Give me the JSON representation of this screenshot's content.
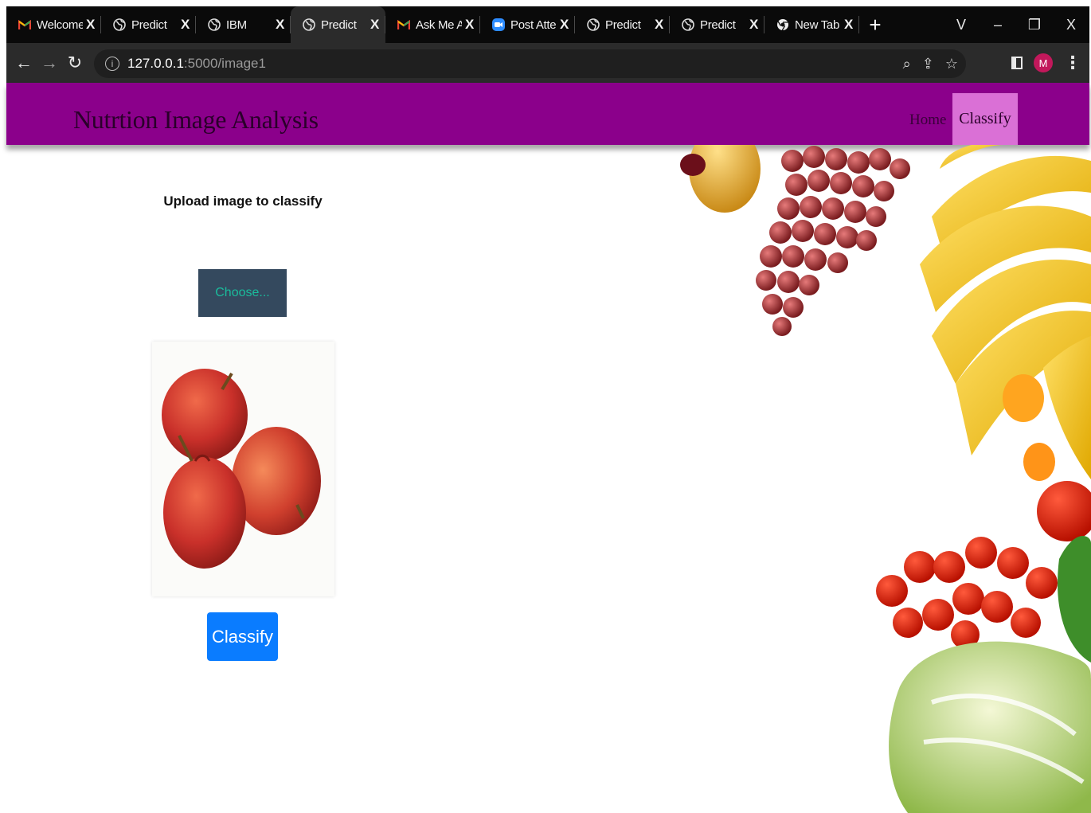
{
  "browser": {
    "tabs": [
      {
        "title": "Welcome t",
        "icon": "gmail-icon",
        "active": false
      },
      {
        "title": "Predict",
        "icon": "globe-icon",
        "active": false
      },
      {
        "title": "IBM",
        "icon": "globe-icon",
        "active": false
      },
      {
        "title": "Predict",
        "icon": "globe-icon",
        "active": true
      },
      {
        "title": "Ask Me Ar",
        "icon": "gmail-icon",
        "active": false
      },
      {
        "title": "Post Atten",
        "icon": "zoom-icon",
        "active": false
      },
      {
        "title": "Predict",
        "icon": "globe-icon",
        "active": false
      },
      {
        "title": "Predict",
        "icon": "globe-icon",
        "active": false
      },
      {
        "title": "New Tab",
        "icon": "chrome-icon",
        "active": false
      }
    ],
    "tab_close": "X",
    "new_tab": "+",
    "window_controls": {
      "dropdown": "V",
      "minimize": "–",
      "restore": "❐",
      "close": "X"
    },
    "url_host": "127.0.0.1",
    "url_path": ":5000/image1",
    "avatar_letter": "M"
  },
  "navbar": {
    "brand": "Nutrtion Image Analysis",
    "links": {
      "home": "Home",
      "classify": "Classify"
    },
    "bg_color": "#8b008b",
    "active_color": "#da70d6"
  },
  "main": {
    "upload_label": "Upload image to classify",
    "choose_button": "Choose...",
    "classify_button": "Classify",
    "accent_color": "#0a7cff"
  }
}
